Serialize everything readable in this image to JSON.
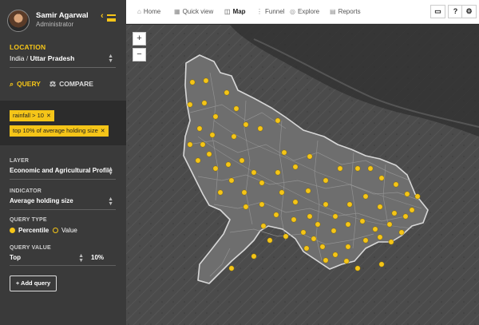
{
  "user": {
    "name": "Samir Agarwal",
    "role": "Administrator"
  },
  "location": {
    "label": "LOCATION",
    "country": "India",
    "separator": "/",
    "state": "Uttar Pradesh"
  },
  "tabs": {
    "query": "QUERY",
    "compare": "COMPARE"
  },
  "filters": [
    {
      "label": "rainfall > 10"
    },
    {
      "label": "top 10% of average holding size"
    }
  ],
  "layer": {
    "label": "LAYER",
    "value": "Economic and Agricultural Profile"
  },
  "indicator": {
    "label": "INDICATOR",
    "value": "Average holding size"
  },
  "query_type": {
    "label": "QUERY TYPE",
    "options": [
      "Percentile",
      "Value"
    ],
    "selected": "Percentile"
  },
  "query_value": {
    "label": "QUERY VALUE",
    "operator": "Top",
    "value": "10%"
  },
  "add_query": "+ Add query",
  "nav": {
    "home": "Home",
    "quick_view": "Quick view",
    "map": "Map",
    "funnel": "Funnel",
    "explore": "Explore",
    "reports": "Reports"
  },
  "toolbar": {
    "help": "?"
  },
  "map": {
    "zoom_in": "+",
    "zoom_out": "−"
  },
  "colors": {
    "accent": "#f5c518",
    "sidebar": "#3a3a3a",
    "marker": "#f5c518"
  }
}
